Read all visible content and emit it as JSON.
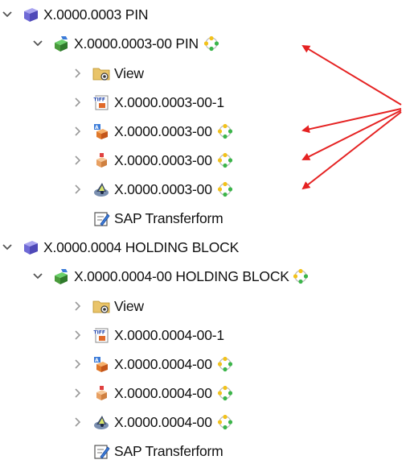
{
  "colors": {
    "arrow": "#e52222",
    "chevron": "#666666",
    "part_icon": "#6f6ad6",
    "doc_icon": "#4a9b3c",
    "status_green": "#3bb54a",
    "status_yellow": "#f2c21b"
  },
  "tree": {
    "items": [
      {
        "label": "X.0000.0003 PIN",
        "icon": "part-cube-icon",
        "toggle": "expanded"
      },
      {
        "label": "X.0000.0003-00 PIN",
        "icon": "document-info-record-icon",
        "toggle": "expanded",
        "status": "status-cycle-icon"
      },
      {
        "label": "View",
        "icon": "view-folder-icon",
        "toggle": "collapsed"
      },
      {
        "label": "X.0000.0003-00-1",
        "icon": "tiff-file-icon",
        "toggle": "collapsed"
      },
      {
        "label": "X.0000.0003-00",
        "icon": "assembly-model-icon",
        "toggle": "collapsed",
        "status": "status-cycle-icon"
      },
      {
        "label": "X.0000.0003-00",
        "icon": "part-model-icon",
        "toggle": "collapsed",
        "status": "status-cycle-icon"
      },
      {
        "label": "X.0000.0003-00",
        "icon": "drawing-model-icon",
        "toggle": "collapsed",
        "status": "status-cycle-icon"
      },
      {
        "label": "SAP Transferform",
        "icon": "transfer-form-icon",
        "toggle": "none"
      },
      {
        "label": "X.0000.0004 HOLDING BLOCK",
        "icon": "part-cube-icon",
        "toggle": "expanded"
      },
      {
        "label": "X.0000.0004-00 HOLDING BLOCK",
        "icon": "document-info-record-icon",
        "toggle": "expanded",
        "status": "status-cycle-icon"
      },
      {
        "label": "View",
        "icon": "view-folder-icon",
        "toggle": "collapsed"
      },
      {
        "label": "X.0000.0004-00-1",
        "icon": "tiff-file-icon",
        "toggle": "collapsed"
      },
      {
        "label": "X.0000.0004-00",
        "icon": "assembly-model-icon",
        "toggle": "collapsed",
        "status": "status-cycle-icon"
      },
      {
        "label": "X.0000.0004-00",
        "icon": "part-model-icon",
        "toggle": "collapsed",
        "status": "status-cycle-icon"
      },
      {
        "label": "X.0000.0004-00",
        "icon": "drawing-model-icon",
        "toggle": "collapsed",
        "status": "status-cycle-icon"
      },
      {
        "label": "SAP Transferform",
        "icon": "transfer-form-icon",
        "toggle": "none"
      }
    ]
  }
}
